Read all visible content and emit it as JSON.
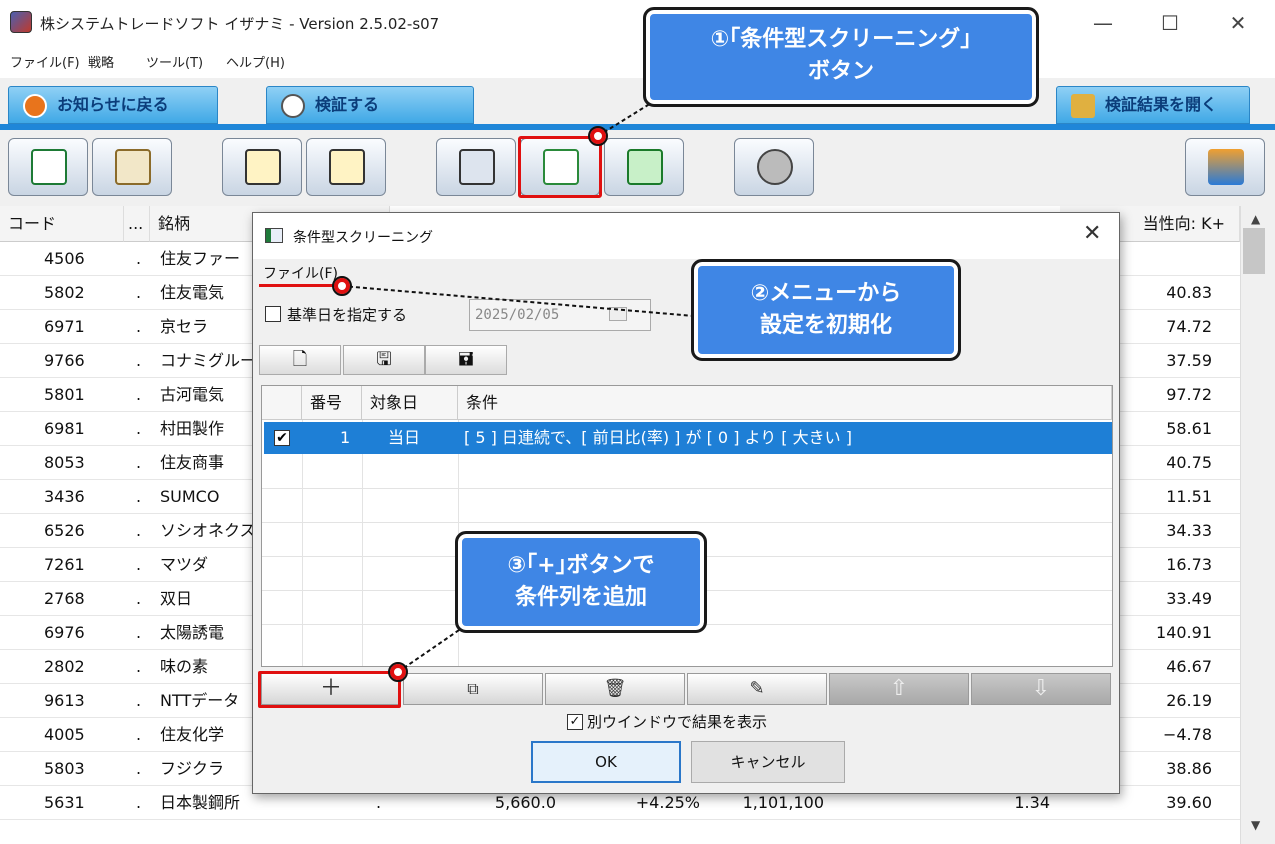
{
  "window": {
    "title": "株システムトレードソフト イザナミ - Version 2.5.02-s07",
    "minimize": "—",
    "maximize": "☐",
    "close": "✕"
  },
  "menu": [
    "ファイル(F)",
    "戦略",
    "ツール(T)",
    "ヘルプ(H)"
  ],
  "tabs": {
    "back": "お知らせに戻る",
    "verify": "検証する",
    "open_results": "検証結果を開く"
  },
  "grid": {
    "headers": {
      "code": "コード",
      "dots": "...",
      "name": "銘柄",
      "last": "当性向: K+"
    },
    "rows": [
      {
        "code": "4506",
        "name": "住友ファー",
        "last": ""
      },
      {
        "code": "5802",
        "name": "住友電気",
        "last": "40.83"
      },
      {
        "code": "6971",
        "name": "京セラ",
        "last": "74.72"
      },
      {
        "code": "9766",
        "name": "コナミグルー",
        "last": "37.59"
      },
      {
        "code": "5801",
        "name": "古河電気",
        "last": "97.72"
      },
      {
        "code": "6981",
        "name": "村田製作",
        "last": "58.61"
      },
      {
        "code": "8053",
        "name": "住友商事",
        "last": "40.75"
      },
      {
        "code": "3436",
        "name": "SUMCO",
        "last": "11.51"
      },
      {
        "code": "6526",
        "name": "ソシオネクス",
        "last": "34.33"
      },
      {
        "code": "7261",
        "name": "マツダ",
        "last": "16.73"
      },
      {
        "code": "2768",
        "name": "双日",
        "last": "33.49"
      },
      {
        "code": "6976",
        "name": "太陽誘電",
        "last": "140.91"
      },
      {
        "code": "2802",
        "name": "味の素",
        "last": "46.67"
      },
      {
        "code": "9613",
        "name": "NTTデータ",
        "last": "26.19"
      },
      {
        "code": "4005",
        "name": "住友化学",
        "last": "−4.78"
      },
      {
        "code": "5803",
        "name": "フジクラ",
        "last": "38.86"
      },
      {
        "code": "5631",
        "name": "日本製鋼所",
        "last": "39.60",
        "c3": ".",
        "price": "5,660.0",
        "chg": "+4.25%",
        "vol": "1,101,100",
        "ratio": "1.34"
      }
    ]
  },
  "dialog": {
    "title": "条件型スクリーニング",
    "menu_file": "ファイル(F)",
    "basedate_label": "基準日を指定する",
    "basedate_value": "2025/02/05",
    "table_headers": {
      "no": "番号",
      "target": "対象日",
      "cond": "条件"
    },
    "row": {
      "no": "1",
      "target": "当日",
      "cond": "[ 5 ] 日連続で、[ 前日比(率) ] が [ 0 ] より [ 大きい ]"
    },
    "separate_window_label": "別ウインドウで結果を表示",
    "ok": "OK",
    "cancel": "キャンセル"
  },
  "callouts": {
    "c1_line1": "①｢条件型スクリーニング｣",
    "c1_line2": "ボタン",
    "c2_line1": "②メニューから",
    "c2_line2": "設定を初期化",
    "c3_line1": "③｢+｣ボタンで",
    "c3_line2": "条件列を追加"
  },
  "colors": {
    "accent": "#1f86d8",
    "highlight": "#e01010",
    "callout": "#3f86e5",
    "selection": "#1e7fd6"
  }
}
